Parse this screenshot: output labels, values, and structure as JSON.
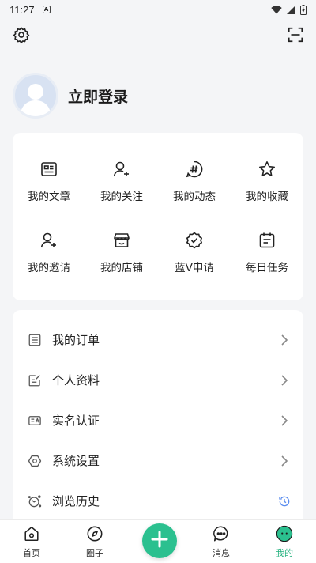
{
  "status_bar": {
    "time": "11:27",
    "notification_glyph": "A"
  },
  "header": {
    "settings_icon": "gear-icon",
    "scan_icon": "scan-icon"
  },
  "profile": {
    "login_text": "立即登录"
  },
  "grid": [
    {
      "label": "我的文章",
      "icon": "article-icon"
    },
    {
      "label": "我的关注",
      "icon": "follow-icon"
    },
    {
      "label": "我的动态",
      "icon": "hashtag-icon"
    },
    {
      "label": "我的收藏",
      "icon": "star-icon"
    },
    {
      "label": "我的邀请",
      "icon": "invite-icon"
    },
    {
      "label": "我的店铺",
      "icon": "store-icon"
    },
    {
      "label": "蓝V申请",
      "icon": "verified-badge-icon"
    },
    {
      "label": "每日任务",
      "icon": "calendar-task-icon"
    }
  ],
  "list": [
    {
      "label": "我的订单",
      "icon": "order-icon",
      "right": "chevron-right-icon"
    },
    {
      "label": "个人资料",
      "icon": "profile-edit-icon",
      "right": "chevron-right-icon"
    },
    {
      "label": "实名认证",
      "icon": "id-card-icon",
      "right": "chevron-right-icon"
    },
    {
      "label": "系统设置",
      "icon": "hexagon-settings-icon",
      "right": "chevron-right-icon"
    },
    {
      "label": "浏览历史",
      "icon": "history-icon",
      "right": "clock-icon"
    }
  ],
  "bottom_nav": [
    {
      "label": "首页",
      "icon": "home-icon"
    },
    {
      "label": "圈子",
      "icon": "compass-icon"
    },
    {
      "label": "",
      "icon": "plus-icon"
    },
    {
      "label": "消息",
      "icon": "message-icon"
    },
    {
      "label": "我的",
      "icon": "me-icon",
      "active": true
    }
  ],
  "colors": {
    "accent": "#2bc08f",
    "background": "#f4f5f7",
    "card": "#ffffff",
    "history_clock": "#5b8def"
  }
}
